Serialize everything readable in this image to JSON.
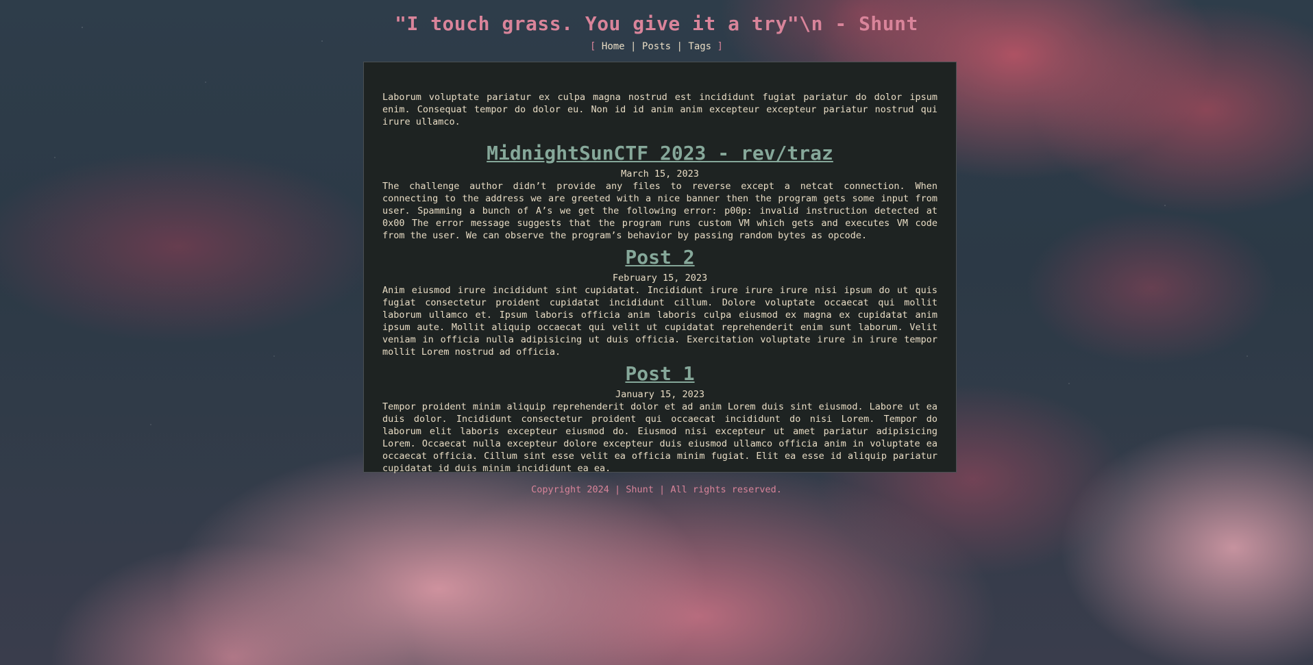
{
  "header": {
    "title": "\"I touch grass. You give it a try\"\\n - Shunt",
    "nav_open": "[",
    "nav_close": "]",
    "nav": [
      "Home",
      "Posts",
      "Tags"
    ],
    "separator": "|"
  },
  "main": {
    "intro": "Laborum voluptate pariatur ex culpa magna nostrud est incididunt fugiat pariatur do dolor ipsum enim. Consequat tempor do dolor eu. Non id id anim anim excepteur excepteur pariatur nostrud qui irure ullamco.",
    "posts": [
      {
        "title": "MidnightSunCTF 2023 - rev/traz",
        "date": "March 15, 2023",
        "summary": "The challenge author didn’t provide any files to reverse except a netcat connection. When connecting to the address we are greeted with a nice banner then the program gets some input from user. Spamming a bunch of A’s we get the following error: p00p: invalid instruction detected at 0x00 The error message suggests that the program runs custom VM which gets and executes VM code from the user. We can observe the program’s behavior by passing random bytes as opcode."
      },
      {
        "title": "Post 2",
        "date": "February 15, 2023",
        "summary": "Anim eiusmod irure incididunt sint cupidatat. Incididunt irure irure irure nisi ipsum do ut quis fugiat consectetur proident cupidatat incididunt cillum. Dolore voluptate occaecat qui mollit laborum ullamco et. Ipsum laboris officia anim laboris culpa eiusmod ex magna ex cupidatat anim ipsum aute. Mollit aliquip occaecat qui velit ut cupidatat reprehenderit enim sunt laborum. Velit veniam in officia nulla adipisicing ut duis officia. Exercitation voluptate irure in irure tempor mollit Lorem nostrud ad officia."
      },
      {
        "title": "Post 1",
        "date": "January 15, 2023",
        "summary": "Tempor proident minim aliquip reprehenderit dolor et ad anim Lorem duis sint eiusmod. Labore ut ea duis dolor. Incididunt consectetur proident qui occaecat incididunt do nisi Lorem. Tempor do laborum elit laboris excepteur eiusmod do. Eiusmod nisi excepteur ut amet pariatur adipisicing Lorem. Occaecat nulla excepteur dolore excepteur duis eiusmod ullamco officia anim in voluptate ea occaecat officia. Cillum sint esse velit ea officia minim fugiat. Elit ea esse id aliquip pariatur cupidatat id duis minim incididunt ea ea."
      }
    ]
  },
  "footer": {
    "text": "Copyright 2024 | Shunt | All rights reserved."
  },
  "colors": {
    "title": "#d9849a",
    "post_link": "#86a89a",
    "text": "#e8dcc4",
    "panel_bg": "#1e2322"
  }
}
